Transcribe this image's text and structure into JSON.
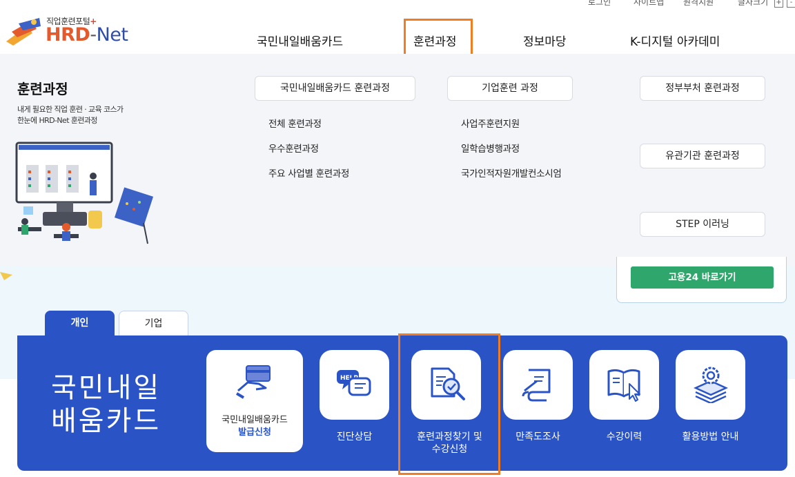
{
  "util": {
    "login": "로그인",
    "sitemap": "사이트맵",
    "remote": "원격지원",
    "fontsize": "글자크기",
    "plus": "+",
    "minus": "-"
  },
  "logo": {
    "top_text": "직업훈련포털",
    "plus": "+",
    "hrd": "HRD",
    "dash": "-",
    "net": "Net"
  },
  "gnb": [
    "국민내일배움카드",
    "훈련과정",
    "정보마당",
    "K-디지털 아카데미"
  ],
  "mega": {
    "title": "훈련과정",
    "desc1": "내게 필요한 직업 훈련 · 교육 코스가",
    "desc2": "한눈에 HRD-Net 훈련과정",
    "col1": {
      "header": "국민내일배움카드 훈련과정",
      "items": [
        "전체 훈련과정",
        "우수훈련과정",
        "주요 사업별 훈련과정"
      ]
    },
    "col2": {
      "header": "기업훈련 과정",
      "items": [
        "사업주훈련지원",
        "일학습병행과정",
        "국가인적자원개발컨소시엄"
      ]
    },
    "col3": [
      "정부부처 훈련과정",
      "유관기관 훈련과정",
      "STEP 이러닝"
    ]
  },
  "goyong_button": "고용24 바로가기",
  "tabs": [
    "개인",
    "기업"
  ],
  "panel": {
    "title_line1": "국민내일",
    "title_line2": "배움카드",
    "services": [
      {
        "label_line1": "국민내일배움카드",
        "label_line2": "발급신청",
        "icon": "card-hand-icon"
      },
      {
        "label_line1": "진단상담",
        "label_line2": "",
        "icon": "help-chat-icon"
      },
      {
        "label_line1": "훈련과정찾기 및",
        "label_line2": "수강신청",
        "icon": "document-search-icon"
      },
      {
        "label_line1": "만족도조사",
        "label_line2": "",
        "icon": "pen-paper-icon"
      },
      {
        "label_line1": "수강이력",
        "label_line2": "",
        "icon": "book-cursor-icon"
      },
      {
        "label_line1": "활용방법 안내",
        "label_line2": "",
        "icon": "gear-layers-icon"
      }
    ]
  },
  "colors": {
    "brand_blue": "#2a54c6",
    "highlight": "#f07d22",
    "green": "#2ea66c",
    "logo_orange": "#e35a2d"
  }
}
